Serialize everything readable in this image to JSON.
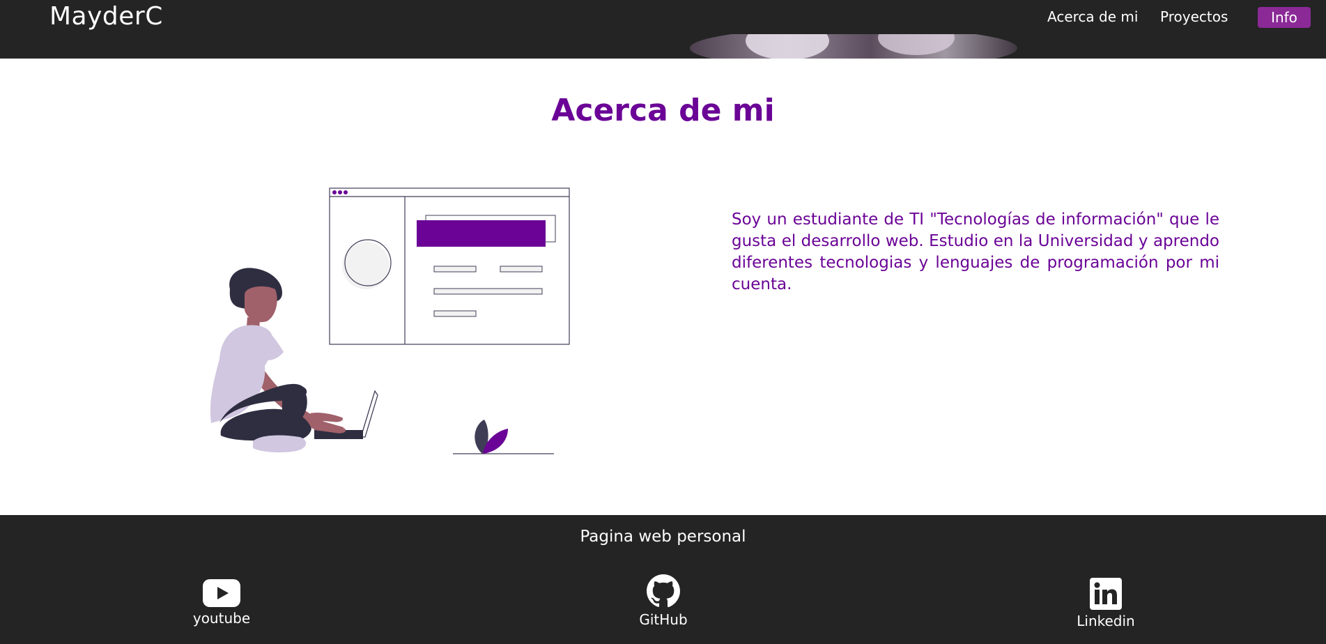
{
  "navbar": {
    "brand": "MayderC",
    "links": [
      {
        "label": "Acerca de mi"
      },
      {
        "label": "Proyectos"
      }
    ],
    "info_button": "Info"
  },
  "about": {
    "title": "Acerca de mi",
    "text": "Soy un estudiante de TI \"Tecnologías de información\" que le gusta el desarrollo web. Estudio en la Universidad y aprendo diferentes tecnologias y lenguajes de programación por mi cuenta."
  },
  "footer": {
    "title": "Pagina web personal",
    "socials": [
      {
        "label": "youtube",
        "icon": "youtube-icon"
      },
      {
        "label": "GitHub",
        "icon": "github-icon"
      },
      {
        "label": "Linkedin",
        "icon": "linkedin-icon"
      }
    ]
  },
  "colors": {
    "navbar_bg": "#242424",
    "accent_purple": "#6a0396",
    "info_button_bg": "#8b2a97",
    "footer_bg": "#242424"
  }
}
